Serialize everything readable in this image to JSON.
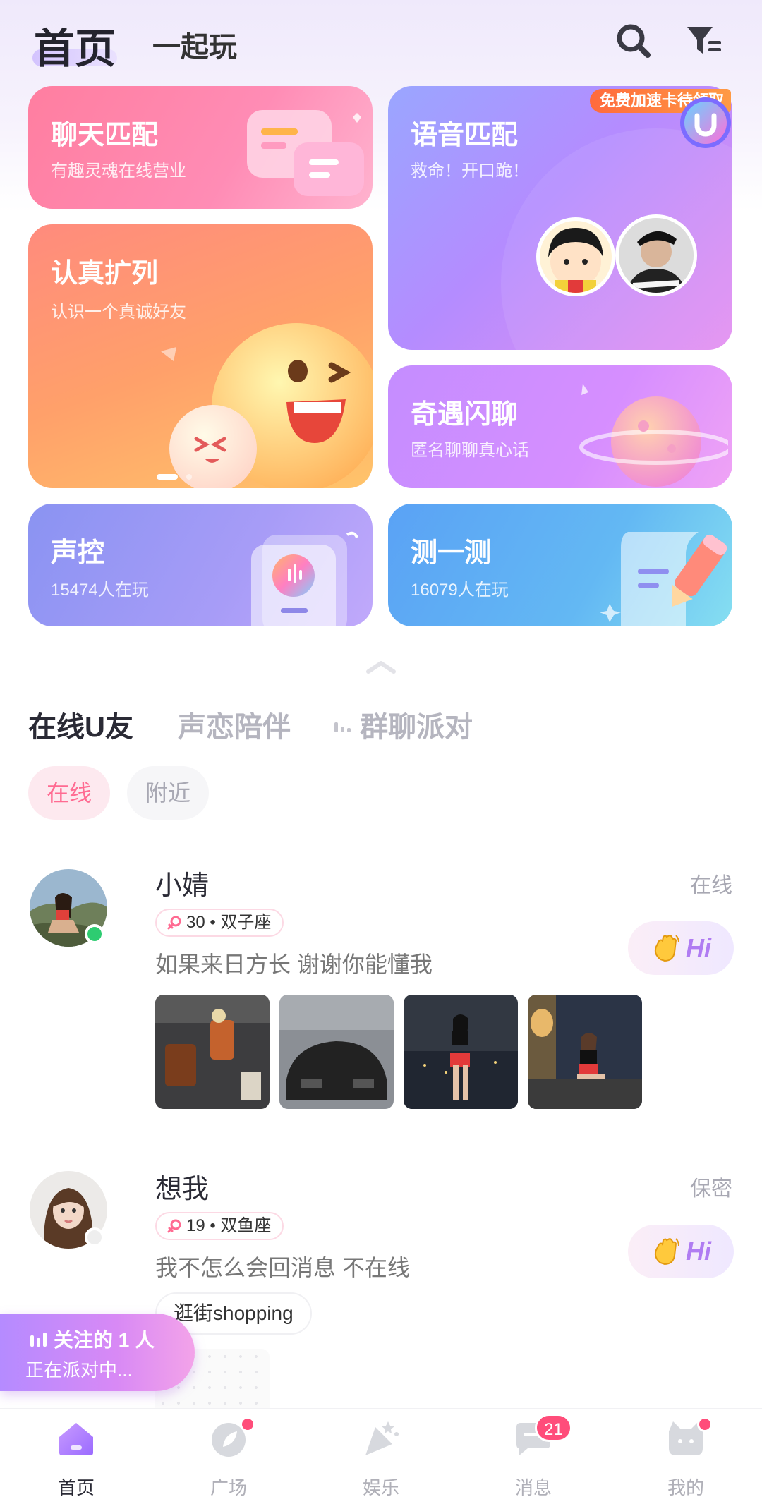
{
  "header": {
    "tabs": [
      "首页",
      "一起玩"
    ],
    "icons": [
      "search-icon",
      "filter-icon"
    ]
  },
  "promo": {
    "badge": "免费加速卡待领取"
  },
  "cards": {
    "chat": {
      "title": "聊天匹配",
      "subtitle": "有趣灵魂在线营业"
    },
    "voice": {
      "title": "语音匹配",
      "subtitle": "救命！开口跪！"
    },
    "friend": {
      "title": "认真扩列",
      "subtitle": "认识一个真诚好友"
    },
    "flash": {
      "title": "奇遇闪聊",
      "subtitle": "匿名聊聊真心话"
    },
    "voicectl": {
      "title": "声控",
      "subtitle": "15474人在玩"
    },
    "test": {
      "title": "测一测",
      "subtitle": "16079人在玩"
    }
  },
  "sections": {
    "tabs": [
      "在线U友",
      "声恋陪伴",
      "群聊派对"
    ],
    "filters": [
      "在线",
      "附近"
    ]
  },
  "users": [
    {
      "name": "小婧",
      "status": "在线",
      "tag": "30 • 双子座",
      "bio": "如果来日方长 谢谢你能懂我",
      "hi": "Hi"
    },
    {
      "name": "想我",
      "status": "保密",
      "tag": "19 • 双鱼座",
      "bio": "我不怎么会回消息 不在线",
      "hi": "Hi",
      "interest": "逛街shopping"
    }
  ],
  "party": {
    "line1": "关注的 1 人",
    "line2": "正在派对中..."
  },
  "nav": {
    "items": [
      "首页",
      "广场",
      "娱乐",
      "消息",
      "我的"
    ],
    "message_badge": "21"
  },
  "colors": {
    "accent_pink": "#ff6b92",
    "accent_purple": "#b07cf2",
    "online_green": "#2ecc71",
    "badge_red": "#ff4d7a"
  }
}
